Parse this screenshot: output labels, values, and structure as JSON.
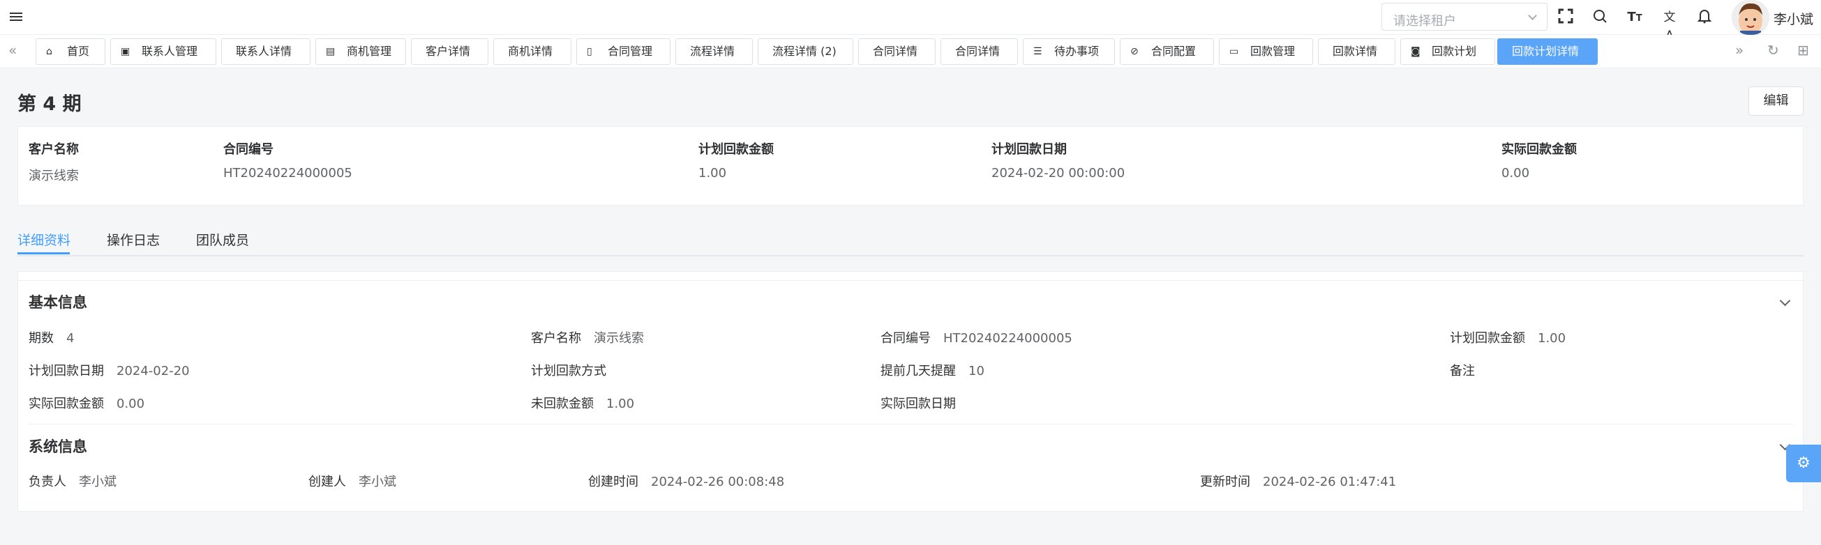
{
  "header": {
    "tenant_placeholder": "请选择租户",
    "username": "李小斌"
  },
  "tabs": [
    {
      "label": "首页",
      "icon": "home-icon"
    },
    {
      "label": "联系人管理",
      "icon": "contact-icon"
    },
    {
      "label": "联系人详情",
      "icon": ""
    },
    {
      "label": "商机管理",
      "icon": "bus-icon"
    },
    {
      "label": "客户详情",
      "icon": ""
    },
    {
      "label": "商机详情",
      "icon": ""
    },
    {
      "label": "合同管理",
      "icon": "document-icon"
    },
    {
      "label": "流程详情",
      "icon": ""
    },
    {
      "label": "流程详情 (2)",
      "icon": ""
    },
    {
      "label": "合同详情",
      "icon": ""
    },
    {
      "label": "合同详情",
      "icon": ""
    },
    {
      "label": "待办事项",
      "icon": "list-icon"
    },
    {
      "label": "合同配置",
      "icon": "link-icon"
    },
    {
      "label": "回款管理",
      "icon": "money-icon"
    },
    {
      "label": "回款详情",
      "icon": ""
    },
    {
      "label": "回款计划",
      "icon": "cash-icon"
    },
    {
      "label": "回款计划详情",
      "icon": "",
      "active": true
    }
  ],
  "page": {
    "title": "第 4 期",
    "edit_label": "编辑"
  },
  "summary": {
    "customer_label": "客户名称",
    "customer_value": "演示线索",
    "contract_no_label": "合同编号",
    "contract_no_value": "HT20240224000005",
    "plan_amount_label": "计划回款金额",
    "plan_amount_value": "1.00",
    "plan_date_label": "计划回款日期",
    "plan_date_value": "2024-02-20 00:00:00",
    "actual_amount_label": "实际回款金额",
    "actual_amount_value": "0.00"
  },
  "detail_tabs": [
    "详细资料",
    "操作日志",
    "团队成员"
  ],
  "basic": {
    "title": "基本信息",
    "period_label": "期数",
    "period_value": "4",
    "customer_label": "客户名称",
    "customer_value": "演示线索",
    "contract_no_label": "合同编号",
    "contract_no_value": "HT20240224000005",
    "plan_amount_label": "计划回款金额",
    "plan_amount_value": "1.00",
    "plan_date_label": "计划回款日期",
    "plan_date_value": "2024-02-20",
    "plan_method_label": "计划回款方式",
    "plan_method_value": "",
    "remind_label": "提前几天提醒",
    "remind_value": "10",
    "remark_label": "备注",
    "remark_value": "",
    "actual_amount_label": "实际回款金额",
    "actual_amount_value": "0.00",
    "unpaid_label": "未回款金额",
    "unpaid_value": "1.00",
    "actual_date_label": "实际回款日期",
    "actual_date_value": ""
  },
  "system": {
    "title": "系统信息",
    "owner_label": "负责人",
    "owner_value": "李小斌",
    "creator_label": "创建人",
    "creator_value": "李小斌",
    "created_label": "创建时间",
    "created_value": "2024-02-26 00:08:48",
    "updated_label": "更新时间",
    "updated_value": "2024-02-26 01:47:41"
  }
}
